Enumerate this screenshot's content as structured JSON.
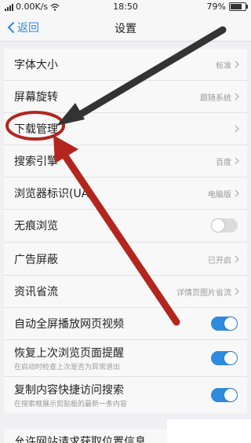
{
  "status_bar": {
    "speed": "0.00K/s",
    "time": "18:50",
    "battery": "79%",
    "battery_level": 0.79
  },
  "nav": {
    "back_label": "返回",
    "title": "设置"
  },
  "group1": [
    {
      "label": "字体大小",
      "value": "标准"
    },
    {
      "label": "屏幕旋转",
      "value": "跟随系统"
    },
    {
      "label": "下载管理",
      "value": ""
    },
    {
      "label": "搜索引擎",
      "value": "百度"
    },
    {
      "label": "浏览器标识(UA)",
      "value": "电脑版"
    },
    {
      "label": "无痕浏览",
      "toggle": "off"
    }
  ],
  "group2": [
    {
      "label": "广告屏蔽",
      "value": "已开启"
    },
    {
      "label": "资讯省流",
      "value": "详情页图片省流"
    },
    {
      "label": "自动全屏播放网页视频",
      "toggle": "on"
    },
    {
      "label": "恢复上次浏览页面提醒",
      "sub": "在启动时检查上次是否为异常退出",
      "toggle": "on"
    },
    {
      "label": "复制内容快捷访问搜索",
      "sub": "在搜索框展示剪贴板的最新一条内容",
      "toggle": "on"
    }
  ],
  "partial_row": {
    "label": "允许网站请求获取位置信息"
  },
  "colors": {
    "accent": "#2d8bde",
    "annotation": "#b3261e",
    "arrow_dark": "#333333"
  }
}
